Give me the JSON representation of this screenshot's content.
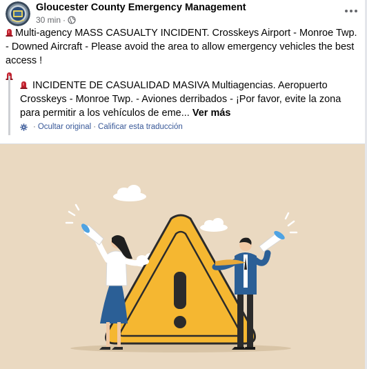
{
  "post": {
    "page_name": "Gloucester County Emergency Management",
    "time": "30 min",
    "meta_separator": "·",
    "privacy_icon": "globe-icon",
    "more_icon": "more-horizontal-icon",
    "body_en": "Multi-agency MASS CASUALTY INCIDENT. Crosskeys Airport - Monroe Twp. - Downed Aircraft - Please avoid the area to allow emergency vehicles the best access !",
    "siren_icon": "emergency-light-icon"
  },
  "translation": {
    "body_es": "INCIDENTE DE CASUALIDAD MASIVA Multiagencias. Aeropuerto Crosskeys - Monroe Twp. - Aviones derribados - ¡Por favor, evite la zona para permitir a los vehículos de eme...",
    "see_more": "Ver más",
    "hide_original": "Ocultar original",
    "separator": "·",
    "rate_translation": "Calificar esta traducción",
    "settings_icon": "gear-icon"
  },
  "image": {
    "subject": "warning-illustration",
    "warning_icon": "warning-triangle-icon",
    "megaphone_icon": "megaphone-icon"
  },
  "colors": {
    "link": "#385898",
    "secondary_text": "#65676b",
    "image_bg": "#ead9c1",
    "warning_yellow": "#f5b731",
    "siren_red": "#c0212e"
  }
}
